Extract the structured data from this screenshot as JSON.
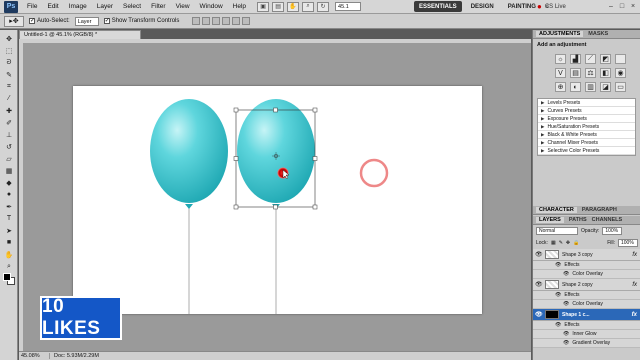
{
  "menubar": {
    "logo": "Ps",
    "items": [
      "File",
      "Edit",
      "Image",
      "Layer",
      "Select",
      "Filter",
      "View",
      "Window",
      "Help"
    ],
    "zoom": "45.1",
    "workspaces": [
      "ESSENTIALS",
      "DESIGN",
      "PAINTING"
    ],
    "cs_live": "CS Live"
  },
  "optionsbar": {
    "auto_select_label": "Auto-Select:",
    "auto_select_value": "Layer",
    "show_transform_label": "Show Transform Controls"
  },
  "document": {
    "tab_title": "Untitled-1 @ 45.1% (RGB/8) *",
    "status_zoom": "45.08%",
    "status_doc": "Doc: 5.93M/2.29M"
  },
  "likes_badge": "10 LIKES",
  "adjustments": {
    "tabs": [
      "ADJUSTMENTS",
      "MASKS"
    ],
    "heading": "Add an adjustment",
    "presets": [
      "Levels Presets",
      "Curves Presets",
      "Exposure Presets",
      "Hue/Saturation Presets",
      "Black & White Presets",
      "Channel Mixer Presets",
      "Selective Color Presets"
    ]
  },
  "panels_mid": {
    "tabs": [
      "CHARACTER",
      "PARAGRAPH"
    ]
  },
  "layers": {
    "tabs": [
      "LAYERS",
      "PATHS",
      "CHANNELS"
    ],
    "blend_mode": "Normal",
    "opacity_label": "Opacity:",
    "opacity_value": "100%",
    "lock_label": "Lock:",
    "fill_label": "Fill:",
    "fill_value": "100%",
    "fx": "fx",
    "effects_label": "Effects",
    "rows": [
      {
        "name": "Shape 3 copy",
        "effects": [
          "Color Overlay"
        ]
      },
      {
        "name": "Shape 2 copy",
        "effects": [
          "Color Overlay"
        ]
      },
      {
        "name": "Shape 1 c...",
        "effects": [
          "Inner Glow",
          "Gradient Overlay"
        ],
        "selected": true
      }
    ]
  },
  "colors": {
    "balloon": "#3fc6cf",
    "badge": "#1457c7",
    "selection": "#2b68b8"
  }
}
